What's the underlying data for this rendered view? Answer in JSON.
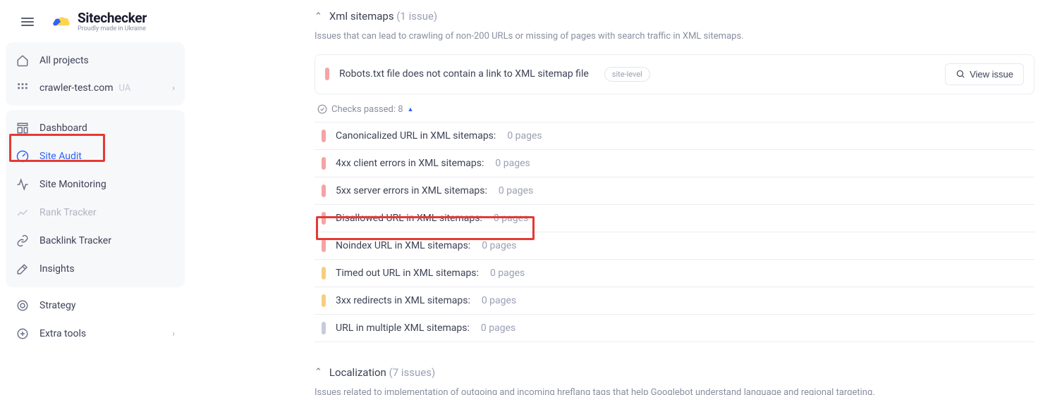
{
  "brand": {
    "name": "Sitechecker",
    "tagline": "Proudly made in Ukraine"
  },
  "sidebar": {
    "all_projects": "All projects",
    "project": {
      "name": "crawler-test.com",
      "suffix": "UA"
    },
    "items": [
      {
        "label": "Dashboard"
      },
      {
        "label": "Site Audit"
      },
      {
        "label": "Site Monitoring"
      },
      {
        "label": "Rank Tracker"
      },
      {
        "label": "Backlink Tracker"
      },
      {
        "label": "Insights"
      }
    ],
    "footer": [
      {
        "label": "Strategy"
      },
      {
        "label": "Extra tools"
      }
    ]
  },
  "main": {
    "section1": {
      "title": "Xml sitemaps",
      "count": "(1 issue)",
      "desc": "Issues that can lead to crawling of non-200 URLs or missing of pages with search traffic in XML sitemaps.",
      "issue": {
        "text": "Robots.txt file does not contain a link to XML sitemap file",
        "badge": "site-level",
        "view": "View issue"
      },
      "checks": "Checks passed: 8",
      "rows": [
        {
          "label": "Canonicalized URL in XML sitemaps:",
          "pages": "0 pages",
          "color": "red"
        },
        {
          "label": "4xx client errors in XML sitemaps:",
          "pages": "0 pages",
          "color": "red"
        },
        {
          "label": "5xx server errors in XML sitemaps:",
          "pages": "0 pages",
          "color": "red"
        },
        {
          "label": "Disallowed URL in XML sitemaps:",
          "pages": "0 pages",
          "color": "red"
        },
        {
          "label": "Noindex URL in XML sitemaps:",
          "pages": "0 pages",
          "color": "red"
        },
        {
          "label": "Timed out URL in XML sitemaps:",
          "pages": "0 pages",
          "color": "orange"
        },
        {
          "label": "3xx redirects in XML sitemaps:",
          "pages": "0 pages",
          "color": "orange"
        },
        {
          "label": "URL in multiple XML sitemaps:",
          "pages": "0 pages",
          "color": "gray"
        }
      ]
    },
    "section2": {
      "title": "Localization",
      "count": "(7 issues)",
      "desc": "Issues related to implementation of outgoing and incoming hreflang tags that help Googlebot understand language and regional targeting."
    }
  }
}
